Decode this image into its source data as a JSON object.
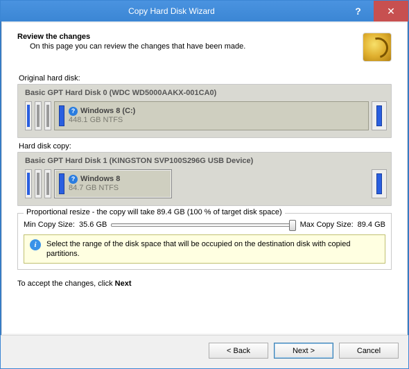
{
  "window": {
    "title": "Copy Hard Disk Wizard"
  },
  "header": {
    "title": "Review the changes",
    "subtitle": "On this page you can review the changes that have been made."
  },
  "original": {
    "label": "Original hard disk:",
    "disk_title": "Basic GPT Hard Disk 0 (WDC WD5000AAKX-001CA0)",
    "partition": {
      "name": "Windows 8 (C:)",
      "size": "448.1 GB NTFS"
    }
  },
  "copy": {
    "label": "Hard disk copy:",
    "disk_title": "Basic GPT Hard Disk 1 (KINGSTON  SVP100S296G USB Device)",
    "partition": {
      "name": "Windows 8",
      "size": "84.7 GB NTFS"
    }
  },
  "resize": {
    "legend": "Proportional resize - the copy will take 89.4 GB (100 % of target disk space)",
    "min_label": "Min Copy Size:",
    "min_value": "35.6 GB",
    "max_label": "Max Copy Size:",
    "max_value": "89.4 GB",
    "info": "Select the range of the disk space that will be occupied on the destination disk with copied partitions."
  },
  "accept": {
    "prefix": "To accept the changes, click ",
    "bold": "Next"
  },
  "buttons": {
    "back": "< Back",
    "next": "Next >",
    "cancel": "Cancel",
    "help": "?",
    "close": "✕"
  }
}
